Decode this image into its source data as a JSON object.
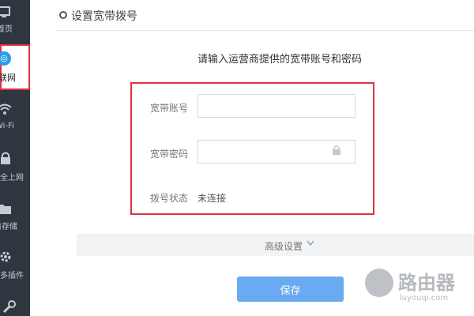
{
  "sidebar": {
    "items": [
      {
        "label": "首页",
        "icon": "monitor-icon"
      },
      {
        "label": "联网",
        "icon": "globe-icon",
        "active": true
      },
      {
        "label": "Wi-Fi",
        "icon": "wifi-icon"
      },
      {
        "label": "安全上网",
        "icon": "lock-icon"
      },
      {
        "label": "自存储",
        "icon": "folder-icon"
      },
      {
        "label": "更多插件",
        "icon": "gear-icon"
      },
      {
        "label": "",
        "icon": "wrench-icon"
      }
    ]
  },
  "header": {
    "title": "设置宽带拨号"
  },
  "form": {
    "subtitle": "请输入运营商提供的宽带账号和密码",
    "account_label": "宽带账号",
    "account_value": "",
    "password_label": "宽带密码",
    "password_value": "",
    "status_label": "拨号状态",
    "status_value": "未连接"
  },
  "advanced": {
    "label": "高级设置"
  },
  "actions": {
    "save_label": "保存"
  },
  "watermark": {
    "brand": "路由器",
    "url": "luyouqi.com"
  },
  "colors": {
    "accent": "#6aaaf0",
    "highlight": "#e0313f",
    "sidebar": "#2f3640"
  }
}
